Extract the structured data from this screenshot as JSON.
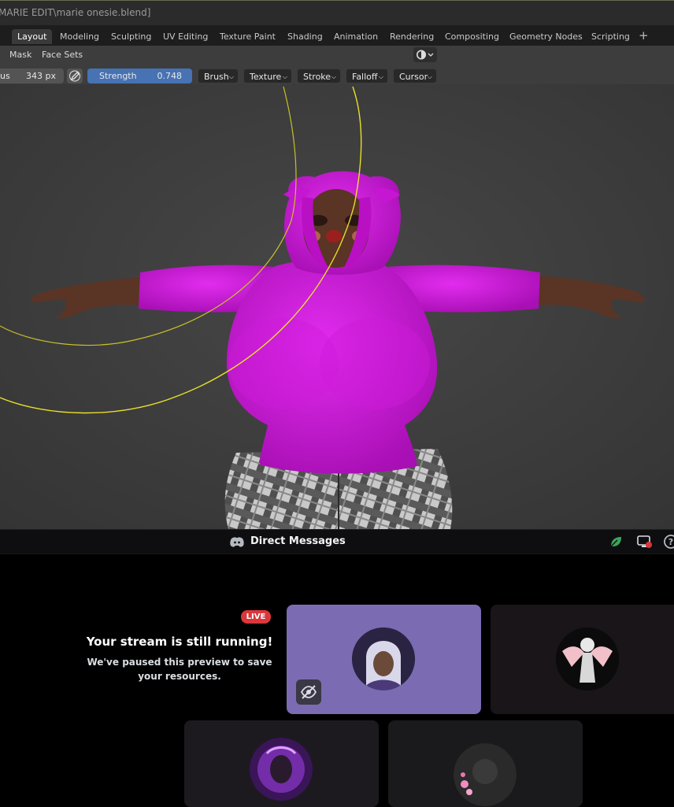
{
  "window": {
    "title": "MARIE EDIT\\marie onesie.blend]"
  },
  "workspace_tabs": [
    {
      "label": "Layout",
      "active": true
    },
    {
      "label": "Modeling"
    },
    {
      "label": "Sculpting"
    },
    {
      "label": "UV Editing"
    },
    {
      "label": "Texture Paint"
    },
    {
      "label": "Shading"
    },
    {
      "label": "Animation"
    },
    {
      "label": "Rendering"
    },
    {
      "label": "Compositing"
    },
    {
      "label": "Geometry Nodes"
    },
    {
      "label": "Scripting"
    },
    {
      "label": "+"
    }
  ],
  "header": {
    "mask": "Mask",
    "face_sets": "Face Sets"
  },
  "tool_settings": {
    "radius_label": "us",
    "radius_value": "343 px",
    "strength_label": "Strength",
    "strength_value": "0.748",
    "dropdowns": [
      "Brush",
      "Texture",
      "Stroke",
      "Falloff",
      "Cursor"
    ]
  },
  "discord": {
    "header_title": "Direct Messages",
    "live_badge": "LIVE",
    "stream_title": "Your stream is still running!",
    "stream_subtitle": "We've paused this preview to save your resources."
  },
  "colors": {
    "hoodie": "#d419df",
    "skin": "#5a3424",
    "strength_field": "#4772b3",
    "live": "#da373c",
    "active_tile": "#7b6bb2",
    "brush_circle": "#c8c12a"
  },
  "icons": [
    "viewport-shading-icon",
    "pen-pressure-icon",
    "discord-icon",
    "nitro-leaf-icon",
    "screen-share-icon",
    "help-icon",
    "hidden-eye-icon"
  ]
}
